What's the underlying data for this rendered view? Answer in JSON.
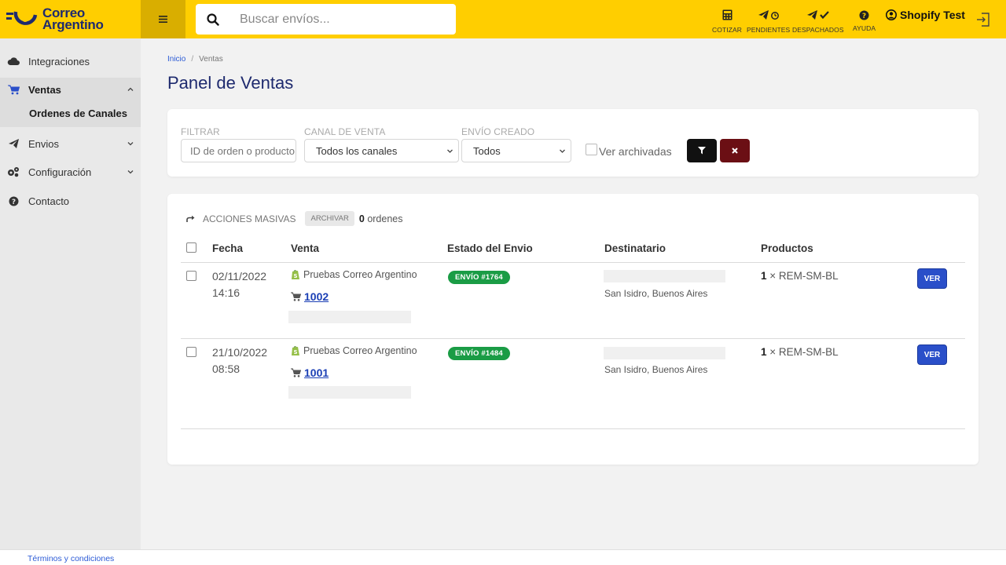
{
  "app": {
    "logo_line1": "Correo",
    "logo_line2": "Argentino",
    "brand_color": "#ffce00",
    "brand_dark": "#1e2a6e"
  },
  "search": {
    "placeholder": "Buscar envíos..."
  },
  "header_actions": [
    {
      "icon": "calculator-icon",
      "label": "COTIZAR"
    },
    {
      "icon": "paper-plane-clock-icon",
      "label": "PENDIENTES"
    },
    {
      "icon": "paper-plane-check-icon",
      "label": "DESPACHADOS"
    },
    {
      "icon": "question-circle-icon",
      "label": "AYUDA"
    }
  ],
  "user": {
    "name": "Shopify Test"
  },
  "sidebar": {
    "items": [
      {
        "label": "Integraciones",
        "icon": "cloud-icon"
      },
      {
        "label": "Ventas",
        "icon": "cart-icon",
        "expanded": true
      },
      {
        "label": "Ordenes de Canales"
      },
      {
        "label": "Envios",
        "icon": "paper-plane-icon"
      },
      {
        "label": "Configuración",
        "icon": "gears-icon"
      },
      {
        "label": "Contacto",
        "icon": "question-circle-icon"
      }
    ]
  },
  "breadcrumb": {
    "home": "Inicio",
    "current": "Ventas"
  },
  "page": {
    "title": "Panel de Ventas"
  },
  "filters": {
    "filter_label": "FILTRAR",
    "filter_placeholder": "ID de orden o producto",
    "channel_label": "CANAL DE VENTA",
    "channel_value": "Todos los canales",
    "created_label": "ENVÍO CREADO",
    "created_value": "Todos",
    "archived_label": "Ver archivadas"
  },
  "mass_actions": {
    "label": "ACCIONES MASIVAS",
    "archive_label": "ARCHIVAR",
    "count": "0",
    "count_suffix": "ordenes"
  },
  "table": {
    "headers": [
      "Fecha",
      "Venta",
      "Estado del Envio",
      "Destinatario",
      "Productos"
    ],
    "rows": [
      {
        "date": "02/11/2022",
        "time": "14:16",
        "store": "Pruebas Correo Argentino",
        "order": "1002",
        "envio": "ENVÍO #1764",
        "destination": "San Isidro, Buenos Aires",
        "qty": "1",
        "product": "× REM-SM-BL",
        "action": "VER"
      },
      {
        "date": "21/10/2022",
        "time": "08:58",
        "store": "Pruebas Correo Argentino",
        "order": "1001",
        "envio": "ENVÍO #1484",
        "destination": "San Isidro, Buenos Aires",
        "qty": "1",
        "product": "× REM-SM-BL",
        "action": "VER"
      }
    ]
  },
  "footer": {
    "terms": "Términos y condiciones"
  }
}
